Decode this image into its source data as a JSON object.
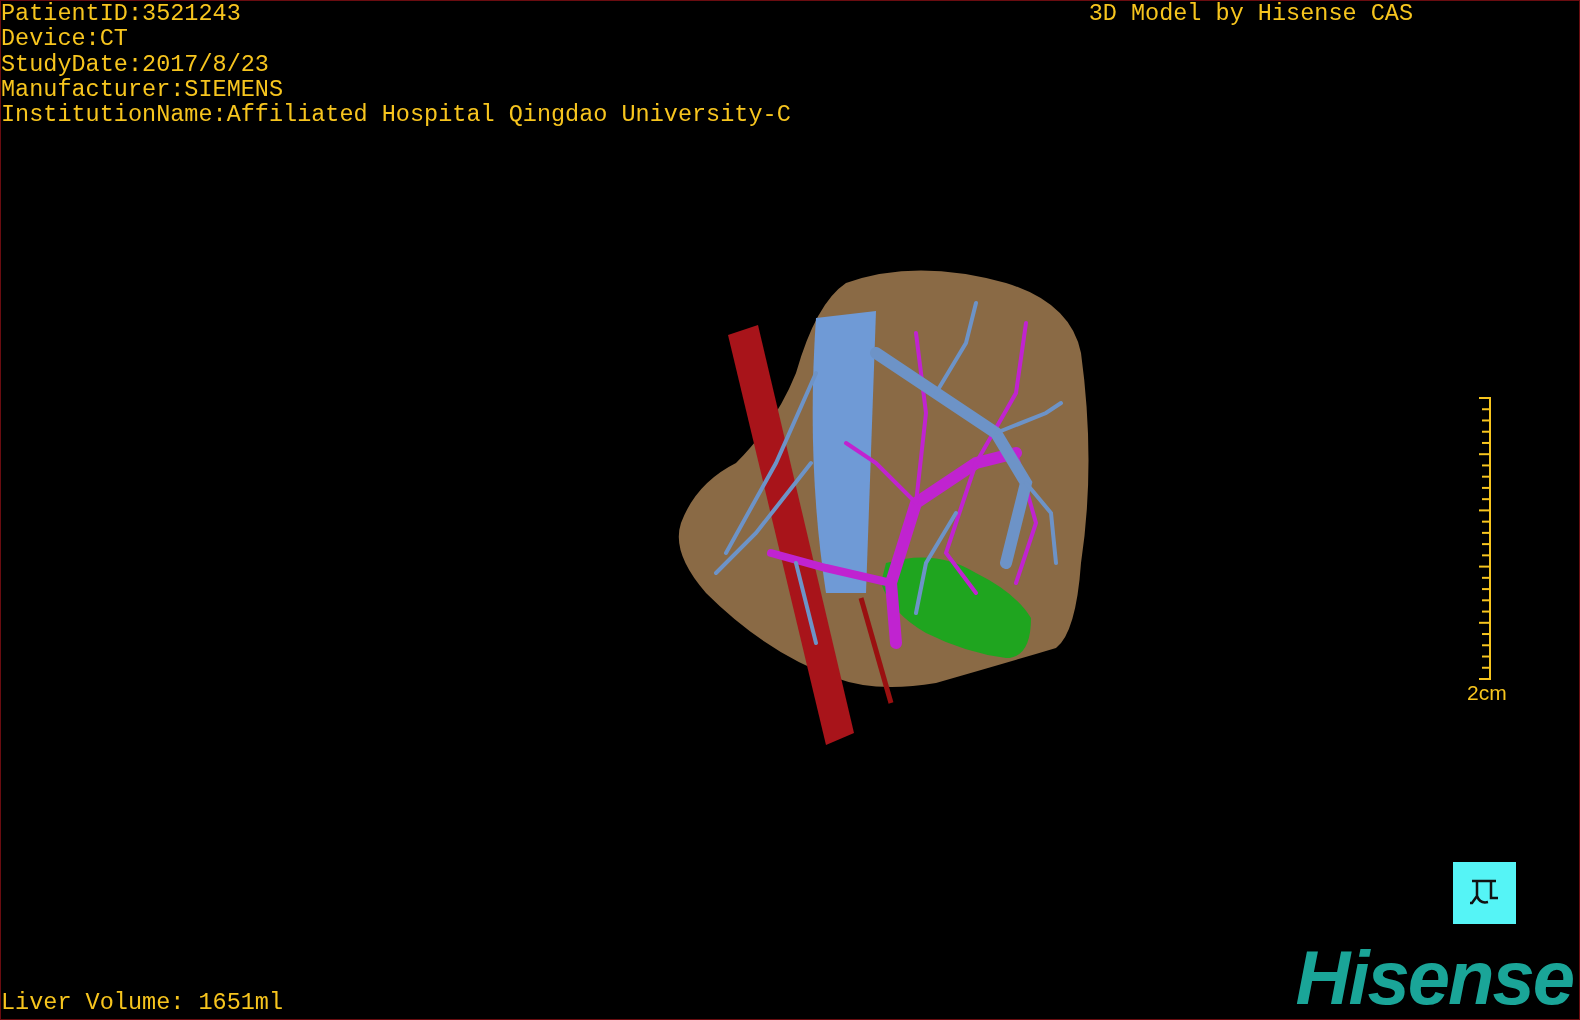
{
  "patient_info": [
    "PatientID:3521243",
    "Device:CT",
    "StudyDate:2017/8/23",
    "Manufacturer:SIEMENS",
    "InstitutionName:Affiliated Hospital Qingdao University-C"
  ],
  "title": "3D Model by Hisense CAS",
  "scale_bar": {
    "label": "2cm"
  },
  "liver_volume": "Liver Volume: 1651ml",
  "logo": "Hisense"
}
